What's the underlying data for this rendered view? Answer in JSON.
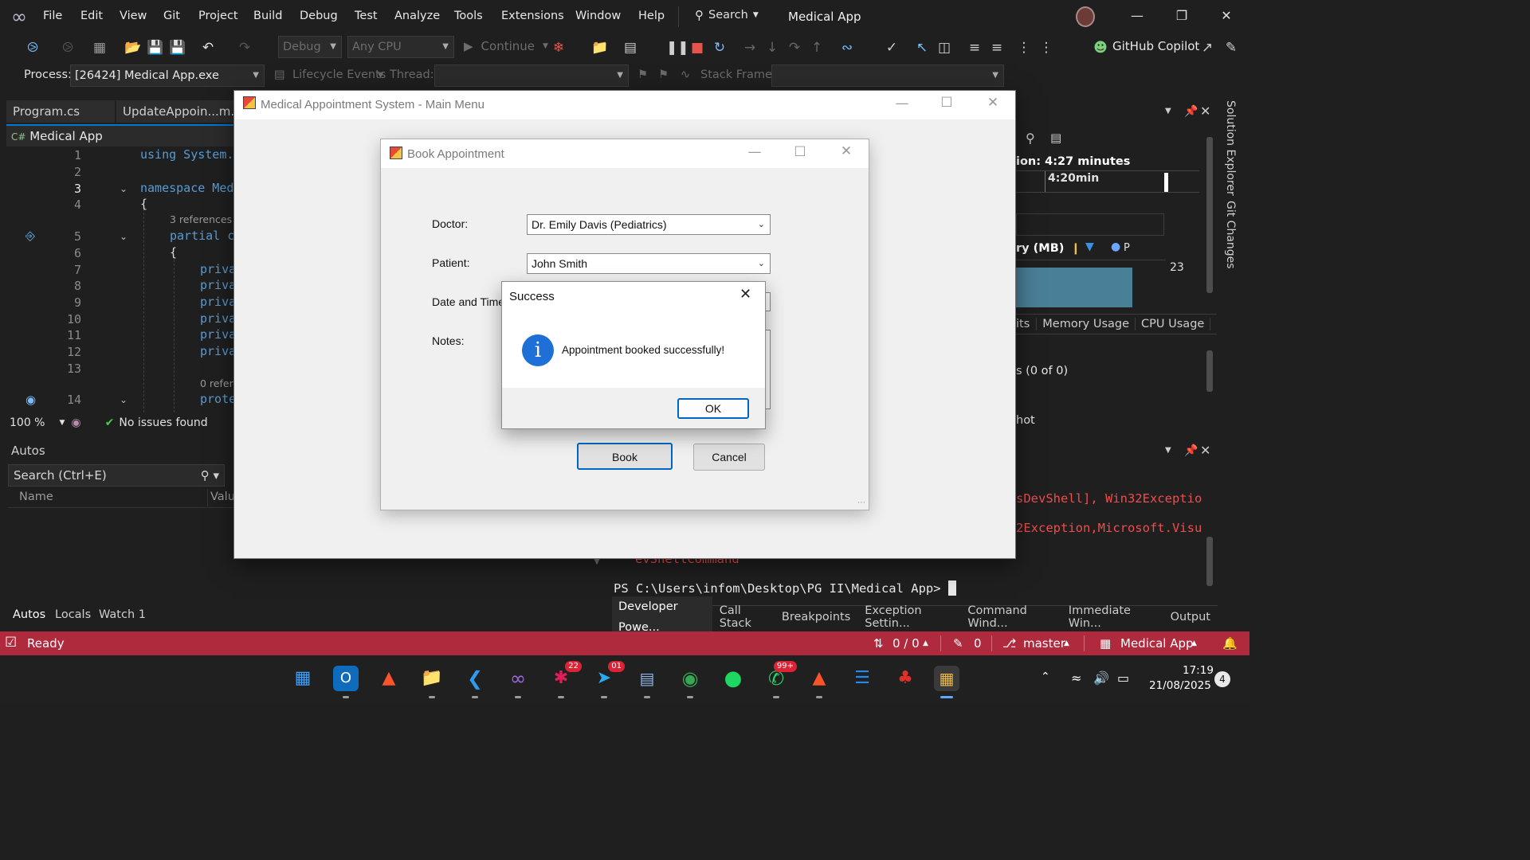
{
  "title_bar": {
    "menu": [
      "File",
      "Edit",
      "View",
      "Git",
      "Project",
      "Build",
      "Debug",
      "Test",
      "Analyze",
      "Tools",
      "Extensions",
      "Window",
      "Help"
    ],
    "search_label": "Search",
    "app_title": "Medical App"
  },
  "toolbar": {
    "configuration": "Debug",
    "platform": "Any CPU",
    "continue_label": "Continue",
    "copilot_label": "GitHub Copilot"
  },
  "debug_location": {
    "process_label": "Process:",
    "process_value": "[26424] Medical App.exe",
    "lifecycle_label": "Lifecycle Events",
    "thread_label": "Thread:",
    "stack_frame_label": "Stack Frame:"
  },
  "editor": {
    "tabs": [
      "Program.cs",
      "UpdateAppoin...m.De"
    ],
    "project": "Medical App",
    "lines": [
      {
        "n": "1",
        "code": "using System."
      },
      {
        "n": "2",
        "code": ""
      },
      {
        "n": "3",
        "code": "namespace Med"
      },
      {
        "n": "4",
        "code": "{"
      },
      {
        "n": "5",
        "code": "partial c"
      },
      {
        "n": "6",
        "code": "{"
      },
      {
        "n": "7",
        "code": "priva"
      },
      {
        "n": "8",
        "code": "priva"
      },
      {
        "n": "9",
        "code": "priva"
      },
      {
        "n": "10",
        "code": "priva"
      },
      {
        "n": "11",
        "code": "priva"
      },
      {
        "n": "12",
        "code": "priva"
      },
      {
        "n": "13",
        "code": ""
      },
      {
        "n": "14",
        "code": "prote"
      }
    ],
    "ref_3": "3 references",
    "ref_0": "0 refere",
    "zoom": "100 %",
    "issues": "No issues found"
  },
  "autos": {
    "title": "Autos",
    "search_placeholder": "Search (Ctrl+E)",
    "col_name": "Name",
    "col_value": "Valu",
    "tabs": [
      "Autos",
      "Locals",
      "Watch 1"
    ]
  },
  "diagnostics": {
    "session": "ion: 4:27 minutes",
    "timeline_tick": "4:20min",
    "memory_label": "ry (MB)",
    "legend_p": "P",
    "memory_value": "23",
    "tabs": [
      "its",
      "Memory Usage",
      "CPU Usage"
    ],
    "events": "s (0 of 0)",
    "snapshot": "hot"
  },
  "side_strip": [
    "Solution Explorer",
    "Git Changes"
  ],
  "terminal": {
    "err1": "sDevShell], Win32Exceptio",
    "err2": "2Exception,Microsoft.Visu",
    "err3": "evShellCommand",
    "prompt": "PS C:\\Users\\infom\\Desktop\\PG II\\Medical App> ",
    "tabs": [
      "Developer Powe...",
      "Call Stack",
      "Breakpoints",
      "Exception Settin...",
      "Command Wind...",
      "Immediate Win...",
      "Output"
    ]
  },
  "status_bar": {
    "ready": "Ready",
    "sync": "0 / 0",
    "edits": "0",
    "branch": "master",
    "repo": "Medical App"
  },
  "taskbar": {
    "slack_badge": "22",
    "telegram_badge": "01",
    "whatsapp_badge": "99+",
    "time": "17:19",
    "date": "21/08/2025",
    "notifications": "4"
  },
  "main_menu_window": {
    "title": "Medical Appointment System - Main Menu"
  },
  "book_dialog": {
    "title": "Book Appointment",
    "doctor_label": "Doctor:",
    "doctor_value": "Dr. Emily Davis (Pediatrics)",
    "patient_label": "Patient:",
    "patient_value": "John Smith",
    "datetime_label": "Date and Time",
    "notes_label": "Notes:",
    "book_button": "Book",
    "cancel_button": "Cancel"
  },
  "message_box": {
    "title": "Success",
    "message": "Appointment booked successfully!",
    "ok_button": "OK"
  },
  "colors": {
    "status_bar": "#b02a3e",
    "accent_blue": "#0078d4",
    "info_icon": "#1e6fd6"
  }
}
